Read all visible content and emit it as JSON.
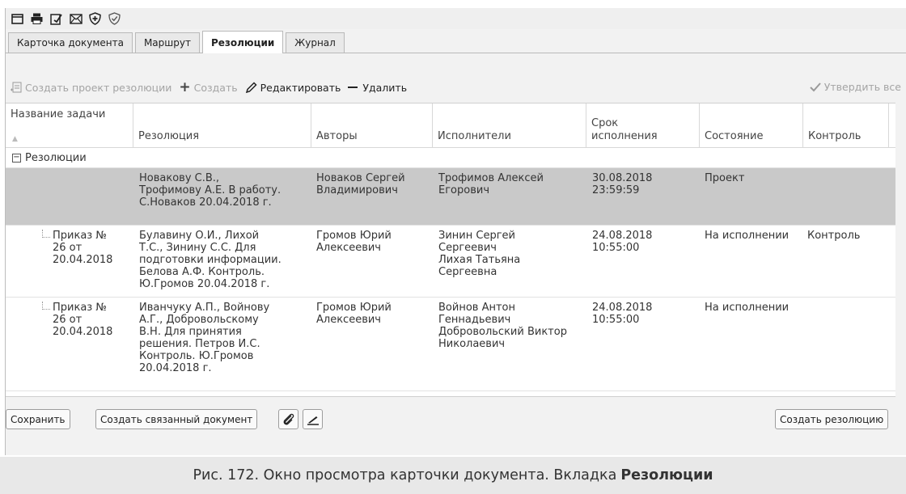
{
  "toolbar_icons": [
    "window-icon",
    "printer-icon",
    "edit-document-icon",
    "envelope-icon",
    "shield-plus-icon",
    "shield-check-icon"
  ],
  "tabs": [
    {
      "label": "Карточка документа",
      "active": false
    },
    {
      "label": "Маршрут",
      "active": false
    },
    {
      "label": "Резолюции",
      "active": true
    },
    {
      "label": "Журнал",
      "active": false
    }
  ],
  "actions": {
    "create_project": "Создать проект резолюции",
    "create": "Создать",
    "edit": "Редактировать",
    "delete": "Удалить",
    "approve_all": "Утвердить все"
  },
  "columns": [
    "Название задачи",
    "Резолюция",
    "Авторы",
    "Исполнители",
    "Срок исполнения",
    "Состояние",
    "Контроль"
  ],
  "columns_wrapped": {
    "deadline_line1": "Срок",
    "deadline_line2": "исполнения"
  },
  "group_label": "Резолюции",
  "rows": [
    {
      "task": [],
      "resolution": [
        "Новакову С.В.,",
        "Трофимову А.Е. В работу.",
        "С.Новаков 20.04.2018 г."
      ],
      "authors": [
        "Новаков Сергей",
        "Владимирович"
      ],
      "executors": [
        "Трофимов Алексей",
        "Егорович"
      ],
      "deadline": [
        "30.08.2018",
        "23:59:59"
      ],
      "state": "Проект",
      "control": "",
      "selected": true
    },
    {
      "task": [
        "Приказ №",
        "26 от",
        "20.04.2018"
      ],
      "resolution": [
        "Булавину О.И., Лихой",
        "Т.С., Зинину С.С. Для",
        "подготовки информации.",
        "Белова А.Ф. Контроль.",
        "Ю.Громов 20.04.2018 г."
      ],
      "authors": [
        "Громов Юрий",
        "Алексеевич"
      ],
      "executors": [
        "Зинин Сергей",
        "Сергеевич",
        "Лихая Татьяна",
        "Сергеевна"
      ],
      "deadline": [
        "24.08.2018",
        "10:55:00"
      ],
      "state": "На исполнении",
      "control": "Контроль",
      "selected": false
    },
    {
      "task": [
        "Приказ №",
        "26 от",
        "20.04.2018"
      ],
      "resolution": [
        "Иванчуку А.П., Войнову",
        "А.Г., Добровольскому",
        "В.Н. Для принятия",
        "решения. Петров И.С.",
        "Контроль. Ю.Громов",
        "20.04.2018 г."
      ],
      "authors": [
        "Громов Юрий",
        "Алексеевич"
      ],
      "executors": [
        "Войнов Антон",
        "Геннадьевич",
        "Добровольский Виктор",
        "Николаевич"
      ],
      "deadline": [
        "24.08.2018",
        "10:55:00"
      ],
      "state": "На исполнении",
      "control": "",
      "selected": false
    }
  ],
  "buttons": {
    "save": "Сохранить",
    "create_linked": "Создать связанный документ",
    "create_resolution": "Создать резолюцию"
  },
  "caption": {
    "prefix": "Рис. 172. Окно просмотра карточки документа. Вкладка",
    "bold": "Резолюции"
  }
}
